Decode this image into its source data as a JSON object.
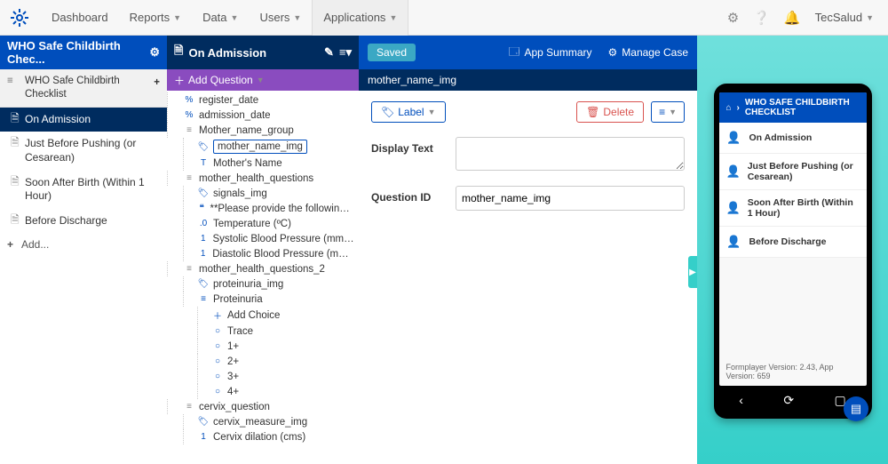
{
  "nav": {
    "items": [
      "Dashboard",
      "Reports",
      "Data",
      "Users",
      "Applications"
    ],
    "active_index": 4,
    "user": "TecSalud"
  },
  "app": {
    "title": "WHO Safe Childbirth Chec...",
    "module_name": "WHO Safe Childbirth Checklist",
    "add_label": "Add...",
    "forms": [
      {
        "label": "On Admission"
      },
      {
        "label": "Just Before Pushing (or Cesarean)"
      },
      {
        "label": "Soon After Birth (Within 1 Hour)"
      },
      {
        "label": "Before Discharge"
      }
    ],
    "active_form_index": 0
  },
  "form_panel": {
    "title": "On Admission",
    "add_question": "Add Question",
    "tree": [
      {
        "depth": 1,
        "type": "hidden",
        "label": "register_date"
      },
      {
        "depth": 1,
        "type": "hidden",
        "label": "admission_date"
      },
      {
        "depth": 1,
        "type": "group",
        "label": "Mother_name_group"
      },
      {
        "depth": 2,
        "type": "image",
        "label": "mother_name_img",
        "selected": true
      },
      {
        "depth": 2,
        "type": "text",
        "label": "Mother's Name"
      },
      {
        "depth": 1,
        "type": "group",
        "label": "mother_health_questions"
      },
      {
        "depth": 2,
        "type": "image",
        "label": "signals_img"
      },
      {
        "depth": 2,
        "type": "label",
        "label": "**Please provide the following information f"
      },
      {
        "depth": 2,
        "type": "decimal",
        "label": "Temperature (ºC)"
      },
      {
        "depth": 2,
        "type": "integer",
        "label": "Systolic Blood Pressure (mmHg)"
      },
      {
        "depth": 2,
        "type": "integer",
        "label": "Diastolic Blood Pressure (mmHg)"
      },
      {
        "depth": 1,
        "type": "group",
        "label": "mother_health_questions_2"
      },
      {
        "depth": 2,
        "type": "image",
        "label": "proteinuria_img"
      },
      {
        "depth": 2,
        "type": "select",
        "label": "Proteinuria"
      },
      {
        "depth": 3,
        "type": "add",
        "label": "Add Choice"
      },
      {
        "depth": 3,
        "type": "choice",
        "label": "Trace"
      },
      {
        "depth": 3,
        "type": "choice",
        "label": "1+"
      },
      {
        "depth": 3,
        "type": "choice",
        "label": "2+"
      },
      {
        "depth": 3,
        "type": "choice",
        "label": "3+"
      },
      {
        "depth": 3,
        "type": "choice",
        "label": "4+"
      },
      {
        "depth": 1,
        "type": "group",
        "label": "cervix_question"
      },
      {
        "depth": 2,
        "type": "image",
        "label": "cervix_measure_img"
      },
      {
        "depth": 2,
        "type": "integer",
        "label": "Cervix dilation (cms)"
      }
    ]
  },
  "detail": {
    "saved": "Saved",
    "app_summary": "App Summary",
    "manage_case": "Manage Case",
    "question_title": "mother_name_img",
    "type_button": "Label",
    "delete": "Delete",
    "display_text_label": "Display Text",
    "display_text_value": "",
    "question_id_label": "Question ID",
    "question_id_value": "mother_name_img"
  },
  "preview": {
    "header": "WHO SAFE CHILDBIRTH CHECKLIST",
    "items": [
      {
        "color": "#d9534f",
        "label": "On Admission"
      },
      {
        "color": "#c23670",
        "label": "Just Before Pushing (or Cesarean)"
      },
      {
        "color": "#f0ad4e",
        "label": "Soon After Birth (Within 1 Hour)"
      },
      {
        "color": "#d9534f",
        "label": "Before Discharge"
      }
    ],
    "footer": "Formplayer Version: 2.43, App Version: 659"
  },
  "icons": {
    "hidden": "%",
    "text": "T",
    "integer": "1",
    "decimal": ".0",
    "group": "≡",
    "image": "🏷",
    "label": "❝",
    "select": "≡",
    "choice": "○",
    "add": "＋"
  }
}
